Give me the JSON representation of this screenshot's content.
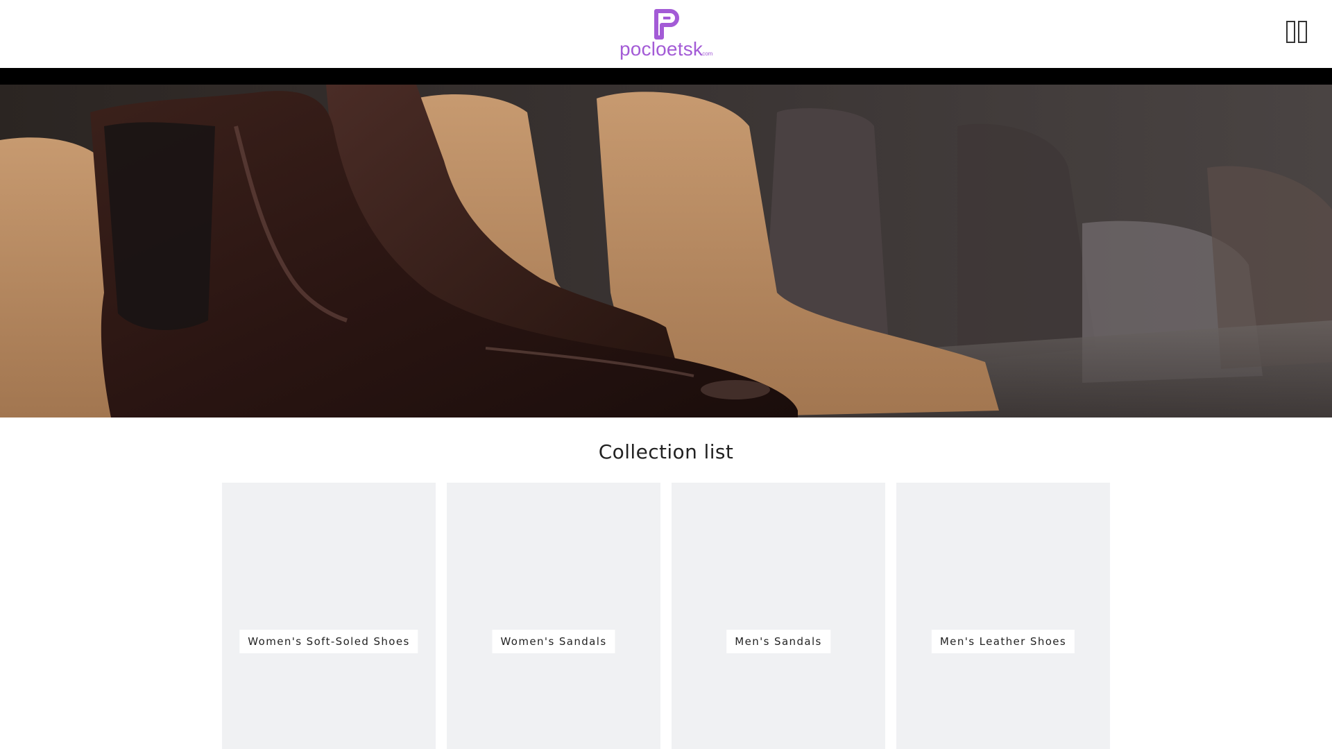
{
  "header": {
    "logo_text": "pocloetsk",
    "logo_suffix": ".com",
    "brand_color": "#a35bd6",
    "menu_icon": "two-pane-icon"
  },
  "hero": {
    "image_description_icon": "leather-boots-photo"
  },
  "collection_section": {
    "title": "Collection list",
    "cards": [
      {
        "label": "Women's Soft-Soled Shoes"
      },
      {
        "label": "Women's Sandals"
      },
      {
        "label": "Men's Sandals"
      },
      {
        "label": "Men's Leather Shoes"
      }
    ]
  }
}
